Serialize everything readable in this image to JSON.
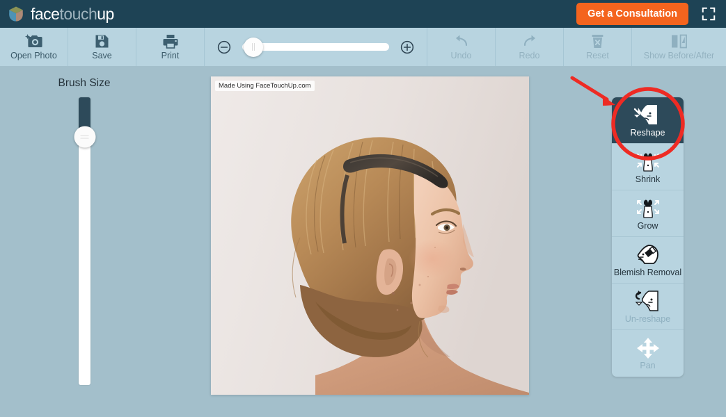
{
  "header": {
    "brand": {
      "word1": "face",
      "word2": "touch",
      "word3": "up",
      "logo_icon": "cube-logo-icon"
    },
    "consultation_button": "Get a Consultation",
    "fullscreen_icon": "fullscreen-icon",
    "bg_color": "#1e4355",
    "accent_color": "#f4641e"
  },
  "toolbar": {
    "bg_color": "#b8d4e0",
    "left_items": [
      {
        "label": "Open Photo",
        "icon": "camera-icon",
        "disabled": false
      },
      {
        "label": "Save",
        "icon": "floppy-disk-icon",
        "disabled": false
      },
      {
        "label": "Print",
        "icon": "printer-icon",
        "disabled": false
      }
    ],
    "zoom": {
      "minus_icon": "zoom-out-circle-icon",
      "plus_icon": "zoom-in-circle-icon",
      "handle_position_percent": 4
    },
    "right_items": [
      {
        "label": "Undo",
        "icon": "undo-arrow-icon",
        "disabled": true
      },
      {
        "label": "Redo",
        "icon": "redo-arrow-icon",
        "disabled": true
      },
      {
        "label": "Reset",
        "icon": "trash-x-icon",
        "disabled": true
      },
      {
        "label": "Show Before/After",
        "icon": "before-after-icon",
        "disabled": true
      }
    ]
  },
  "brush": {
    "title": "Brush Size",
    "fill_percent": 14,
    "handle_percent": 14
  },
  "photo": {
    "watermark": "Made Using FaceTouchUp.com",
    "subject": "woman-profile-portrait"
  },
  "tools": {
    "items": [
      {
        "label": "Reshape",
        "icon": "reshape-face-icon",
        "state": "active"
      },
      {
        "label": "Shrink",
        "icon": "shrink-arrows-icon",
        "state": "normal"
      },
      {
        "label": "Grow",
        "icon": "grow-arrows-icon",
        "state": "normal"
      },
      {
        "label": "Blemish Removal",
        "icon": "blemish-eraser-icon",
        "state": "normal"
      },
      {
        "label": "Un-reshape",
        "icon": "un-reshape-face-icon",
        "state": "dim"
      },
      {
        "label": "Pan",
        "icon": "pan-move-icon",
        "state": "dim"
      }
    ]
  },
  "annotation": {
    "highlight_color": "#ee2b24",
    "circle_target": "Reshape",
    "arrow": "red-pointer-arrow"
  }
}
